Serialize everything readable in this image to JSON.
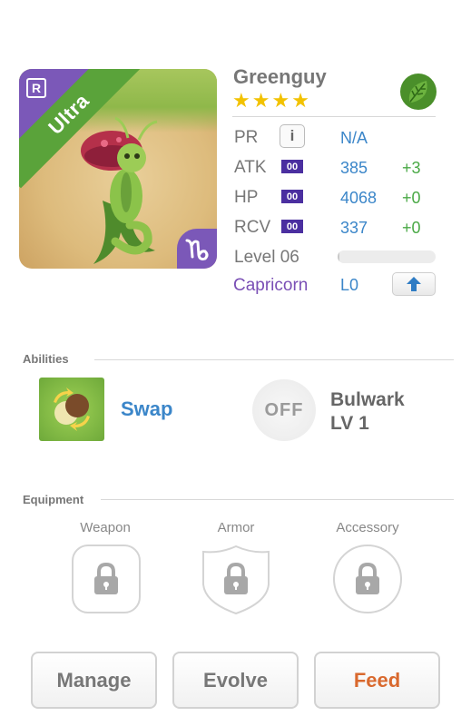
{
  "monster": {
    "name": "Greenguy",
    "stars": [
      "★",
      "★",
      "★",
      "★"
    ],
    "rarity": "Ultra",
    "rank_badge": "R",
    "sign_glyph": "♑",
    "element_icon": "leaf-icon",
    "colors": {
      "rarity_ribbon": "#5aa33a",
      "corner": "#7b58b8",
      "accent_blue": "#3b86c9",
      "accent_green": "#4aa946"
    }
  },
  "stats": {
    "pr": {
      "label": "PR",
      "value": "N/A"
    },
    "atk": {
      "label": "ATK",
      "badge": "00",
      "value": "385",
      "bonus": "+3"
    },
    "hp": {
      "label": "HP",
      "badge": "00",
      "value": "4068",
      "bonus": "+0"
    },
    "rcv": {
      "label": "RCV",
      "badge": "00",
      "value": "337",
      "bonus": "+0"
    },
    "level": {
      "label": "Level 06",
      "progress": 0.02
    },
    "sign": {
      "label": "Capricorn",
      "level": "L0"
    }
  },
  "abilities": {
    "title": "Abilities",
    "items": [
      {
        "name": "Swap",
        "icon": "swap-icon"
      },
      {
        "name": "Bulwark",
        "level": "LV 1",
        "status": "OFF"
      }
    ]
  },
  "equipment": {
    "title": "Equipment",
    "slots": [
      {
        "label": "Weapon",
        "icon": "lock-icon"
      },
      {
        "label": "Armor",
        "icon": "lock-icon"
      },
      {
        "label": "Accessory",
        "icon": "lock-icon"
      }
    ]
  },
  "actions": {
    "manage": "Manage",
    "evolve": "Evolve",
    "feed": "Feed"
  }
}
